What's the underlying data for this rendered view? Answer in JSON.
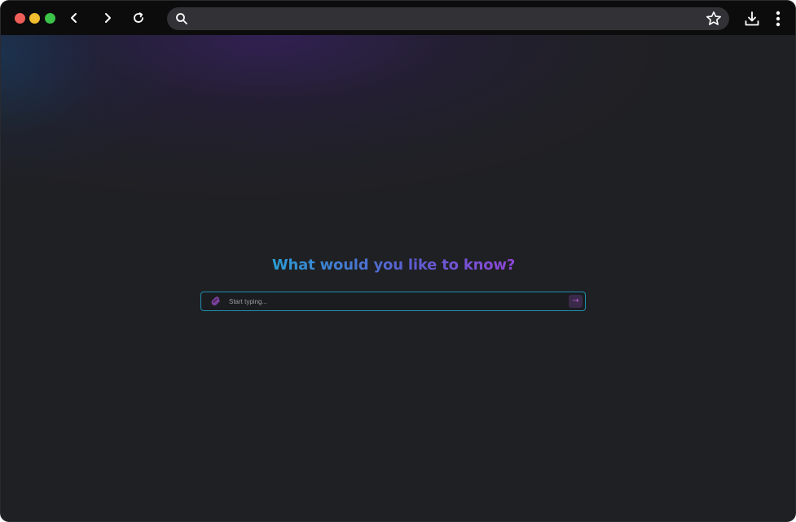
{
  "browser": {
    "address_bar": {
      "value": "",
      "placeholder": ""
    },
    "icons": {
      "back": "chevron-left-icon",
      "forward": "chevron-right-icon",
      "reload": "reload-icon",
      "search": "search-icon",
      "bookmark": "star-icon",
      "download": "download-icon",
      "menu": "kebab-menu-icon"
    },
    "traffic_lights": {
      "close": "#ee5e58",
      "minimize": "#f2be2f",
      "maximize": "#3cc349"
    }
  },
  "main": {
    "heading": "What would you like to know?",
    "prompt": {
      "placeholder": "Start typing...",
      "value": "",
      "send_label": "→",
      "attach_icon": "attachment-icon"
    }
  },
  "colors": {
    "background": "#1f2023",
    "heading_gradient_start": "#2a9bd3",
    "heading_gradient_end": "#8f46d8",
    "input_border": "#1f8fb0",
    "accent": "#c05ad8"
  }
}
